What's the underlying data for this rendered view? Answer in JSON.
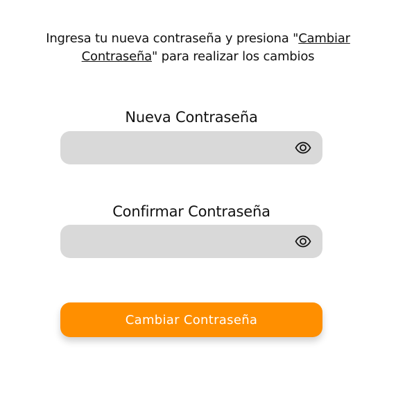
{
  "instructions": {
    "before": "Ingresa tu nueva contraseña y presiona \"",
    "link": "Cambiar Contraseña",
    "after": "\" para realizar los cambios"
  },
  "new_password": {
    "label": "Nueva Contraseña",
    "value": "",
    "placeholder": "",
    "toggle_icon": "eye-icon"
  },
  "confirm_password": {
    "label": "Confirmar Contraseña",
    "value": "",
    "placeholder": "",
    "toggle_icon": "eye-icon"
  },
  "submit": {
    "label": "Cambiar Contraseña"
  },
  "colors": {
    "accent": "#ff8f00",
    "field_bg": "#d9d9d9",
    "text": "#111111"
  }
}
